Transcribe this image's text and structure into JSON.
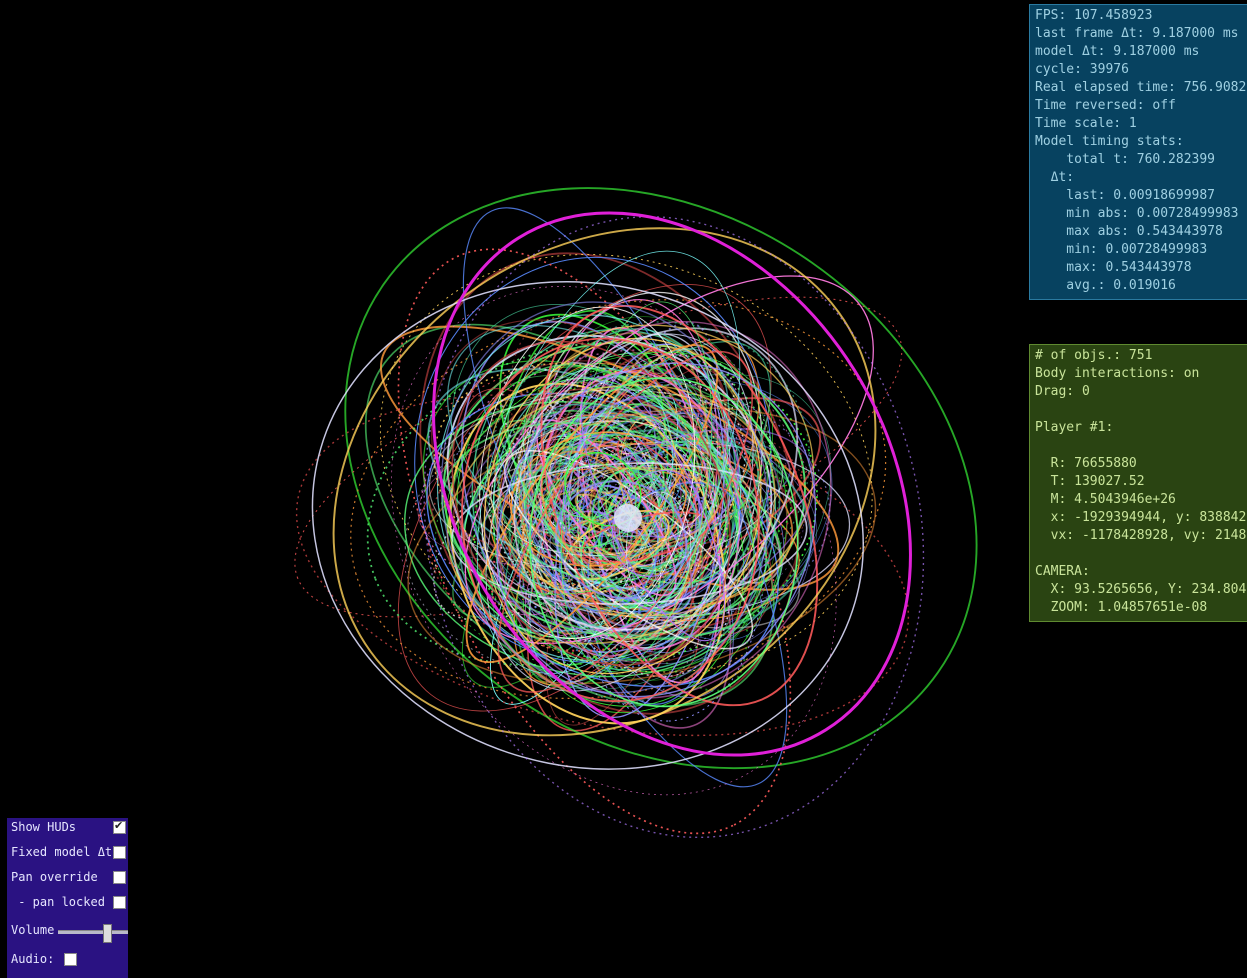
{
  "timing_hud": {
    "lines": [
      "FPS: 107.458923",
      "last frame Δt: 9.187000 ms",
      "model Δt: 9.187000 ms",
      "cycle: 39976",
      "Real elapsed time: 756.9082",
      "Time reversed: off",
      "Time scale: 1",
      "Model timing stats:",
      "    total t: 760.282399",
      "  Δt:",
      "    last: 0.00918699987",
      "    min abs: 0.00728499983",
      "    max abs: 0.543443978",
      "    min: 0.00728499983",
      "    max: 0.543443978",
      "    avg.: 0.019016"
    ]
  },
  "objects_hud": {
    "lines": [
      "# of objs.: 751",
      "Body interactions: on",
      "Drag: 0",
      "",
      "Player #1:",
      "",
      "  R: 76655880",
      "  T: 139027.52",
      "  M: 4.5043946e+26",
      "  x: -1929394944, y: 838842",
      "  vx: -1178428928, vy: 2148",
      "",
      "CAMERA:",
      "  X: 93.5265656, Y: 234.804",
      "  ZOOM: 1.04857651e-08"
    ]
  },
  "controls": {
    "show_huds": {
      "label": "Show HUDs",
      "checked": true
    },
    "fixed_dt": {
      "label": "Fixed model Δt",
      "checked": false
    },
    "pan_override": {
      "label": "Pan override",
      "checked": false
    },
    "pan_locked": {
      "label": " - pan locked",
      "checked": false
    },
    "volume": {
      "label": "Volume",
      "level": 0.7
    },
    "audio": {
      "label": "Audio:",
      "checked": false
    }
  },
  "colors": {
    "background": "#000000",
    "timing_hud_bg": "#074260",
    "objects_hud_bg": "#2a4412",
    "controls_bg": "#2a1282",
    "player_orbit": "#e020d8"
  }
}
